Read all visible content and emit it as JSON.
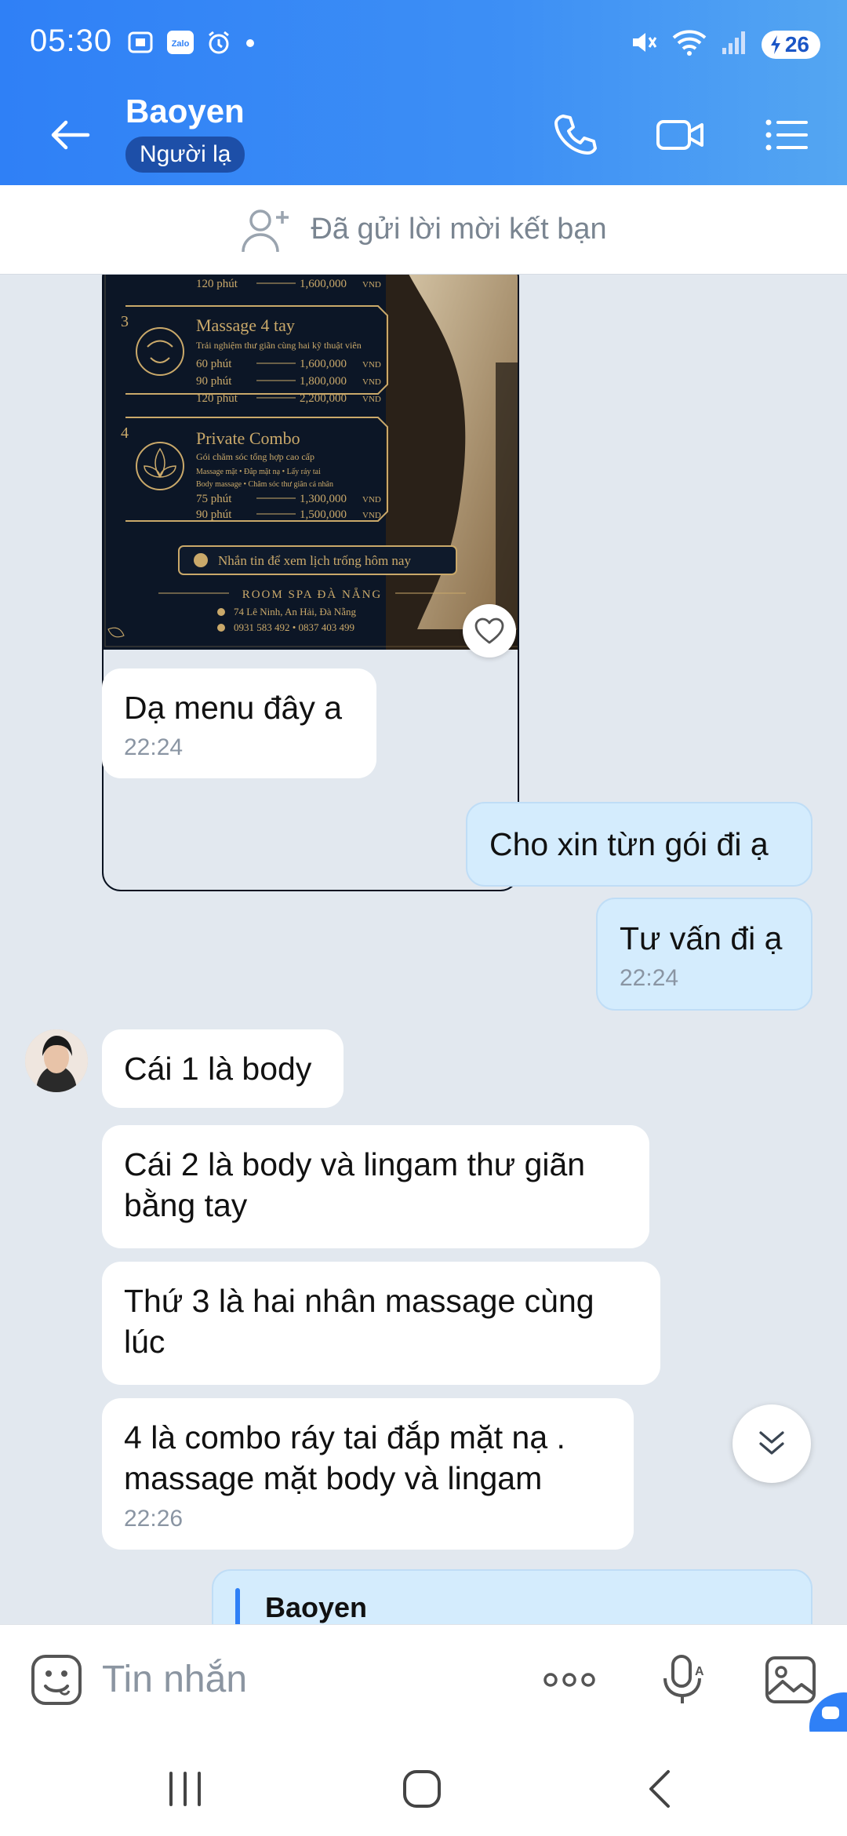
{
  "status_bar": {
    "time": "05:30",
    "battery": "26"
  },
  "header": {
    "contact_name": "Baoyen",
    "badge": "Người lạ"
  },
  "friend_request": {
    "text": "Đã gửi lời mời kết bạn"
  },
  "menu_image": {
    "row_120_1": {
      "label": "120 phút",
      "price": "1,600,000"
    },
    "item3": {
      "number": "3",
      "title": "Massage 4 tay",
      "subtitle": "Trải nghiệm thư giãn cùng hai kỹ thuật viên",
      "rows": [
        {
          "label": "60 phút",
          "price": "1,600,000"
        },
        {
          "label": "90 phút",
          "price": "1,800,000"
        },
        {
          "label": "120 phút",
          "price": "2,200,000"
        }
      ]
    },
    "item4": {
      "number": "4",
      "title": "Private Combo",
      "subtitle": "Gói chăm sóc tổng hợp cao cấp",
      "detail1": "Massage mặt • Đắp mặt nạ • Lấy ráy tai",
      "detail2": "Body massage • Chăm sóc thư giãn cá nhân",
      "rows": [
        {
          "label": "75 phút",
          "price": "1,300,000"
        },
        {
          "label": "90 phút",
          "price": "1,500,000"
        }
      ]
    },
    "currency": "VND",
    "cta": "Nhắn tin để xem lịch trống hôm nay",
    "brand": "ROOM SPA ĐÀ NẴNG",
    "address": "74 Lê Ninh, An Hải, Đà Nẵng",
    "phones": "0931 583 492  •  0837 403 499"
  },
  "messages": [
    {
      "side": "in",
      "text": "Dạ menu đây a",
      "time": "22:24"
    },
    {
      "side": "out",
      "text": "Cho xin từn gói đi ạ",
      "time": ""
    },
    {
      "side": "out",
      "text": "Tư vấn đi ạ",
      "time": "22:24"
    },
    {
      "side": "in",
      "text": "Cái 1 là body",
      "time": ""
    },
    {
      "side": "in",
      "text": "Cái 2 là body và lingam thư giãn bằng tay",
      "time": ""
    },
    {
      "side": "in",
      "text": "Thứ 3 là hai nhân massage cùng lúc",
      "time": ""
    },
    {
      "side": "in",
      "text": "4 là combo ráy tai đắp mặt nạ . massage mặt body và lingam",
      "time": "22:26"
    }
  ],
  "quote": {
    "name": "Baoyen"
  },
  "input": {
    "placeholder": "Tin nhắn"
  },
  "colors": {
    "header_start": "#2f80f6",
    "header_end": "#54a6f2",
    "outgoing_bubble": "#d4ecfd",
    "incoming_bubble": "#ffffff",
    "chat_bg": "#e2e8ef"
  }
}
